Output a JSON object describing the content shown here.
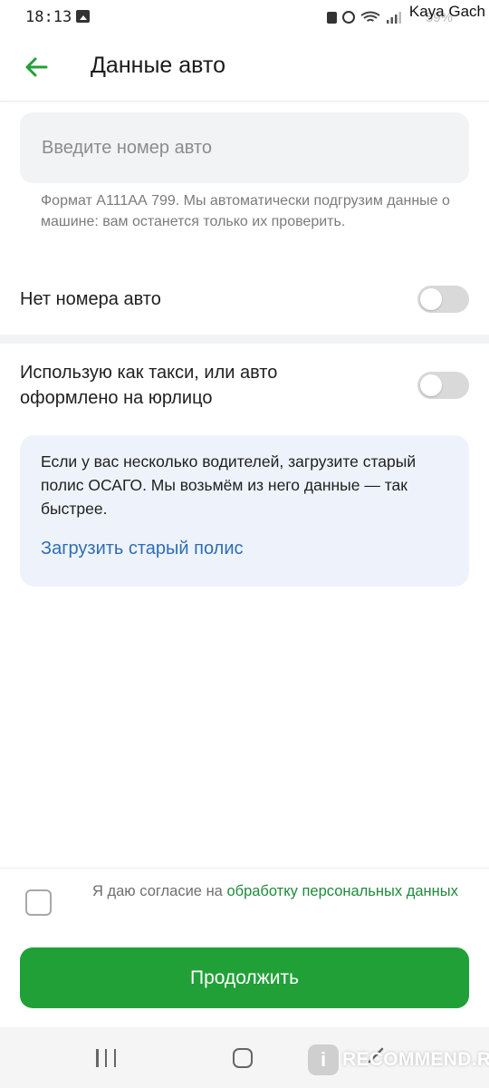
{
  "status_bar": {
    "time": "18:13",
    "battery_text": "59%",
    "watermark_user": "Kaya Gach",
    "icons": [
      "photo-icon",
      "lock-icon",
      "alarm-icon",
      "wifi-icon",
      "signal-icon"
    ]
  },
  "header": {
    "title": "Данные авто",
    "back_icon": "arrow-left-icon"
  },
  "plate": {
    "value": "",
    "placeholder": "Введите номер авто",
    "hint": "Формат А111АА 799. Мы автоматически подгрузим данные о машине: вам останется только их проверить."
  },
  "no_plate": {
    "label": "Нет номера авто",
    "enabled": false
  },
  "taxi": {
    "label": "Использую как такси, или авто оформлено на юрлицо",
    "enabled": false
  },
  "info_card": {
    "text": "Если у вас несколько водителей, загрузите старый полис ОСАГО. Мы возьмём из него данные — так быстрее.",
    "link": "Загрузить старый полис"
  },
  "consent": {
    "checked": false,
    "text_prefix": "Я даю согласие на ",
    "link": "обработку персональных данных"
  },
  "continue_button": {
    "label": "Продолжить"
  },
  "watermark": {
    "badge": "i",
    "text": "RECOMMEND.RU"
  },
  "colors": {
    "accent_green": "#21a038",
    "link_blue": "#2f6db4",
    "info_bg": "#eef3fb",
    "input_bg": "#f2f3f5"
  }
}
